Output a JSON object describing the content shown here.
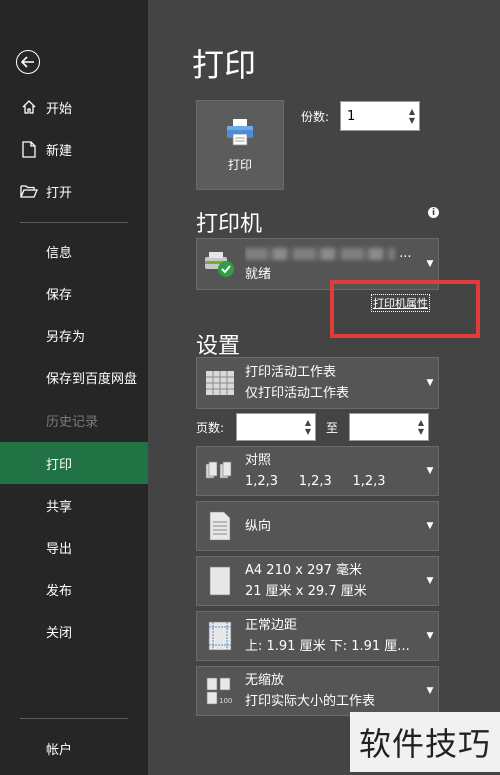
{
  "sidebar": {
    "items": [
      {
        "label": "开始",
        "icon": "home-icon"
      },
      {
        "label": "新建",
        "icon": "new-document-icon"
      },
      {
        "label": "打开",
        "icon": "open-folder-icon"
      },
      {
        "label": "信息"
      },
      {
        "label": "保存"
      },
      {
        "label": "另存为"
      },
      {
        "label": "保存到百度网盘"
      },
      {
        "label": "历史记录",
        "disabled": true
      },
      {
        "label": "打印",
        "active": true
      },
      {
        "label": "共享"
      },
      {
        "label": "导出"
      },
      {
        "label": "发布"
      },
      {
        "label": "关闭"
      },
      {
        "label": "帐户"
      }
    ],
    "active_color": "#217346"
  },
  "main": {
    "title": "打印",
    "print_button_label": "打印",
    "copies_label": "份数:",
    "copies_value": "1",
    "printer_heading": "打印机",
    "printer_status": "就绪",
    "printer_name_suffix": "...",
    "printer_properties": "打印机属性",
    "settings_heading": "设置",
    "settings": [
      {
        "line1": "打印活动工作表",
        "line2": "仅打印活动工作表",
        "icon": "sheet-grid-icon"
      },
      {
        "line1": "对照",
        "line2": "1,2,3     1,2,3     1,2,3",
        "icon": "collate-icon"
      },
      {
        "line1": "纵向",
        "line2": "",
        "icon": "portrait-page-icon"
      },
      {
        "line1": "A4 210 x 297 毫米",
        "line2": "21 厘米 x 29.7 厘米",
        "icon": "paper-size-icon"
      },
      {
        "line1": "正常边距",
        "line2": "上: 1.91 厘米 下: 1.91 厘...",
        "icon": "margins-icon"
      },
      {
        "line1": "无缩放",
        "line2": "打印实际大小的工作表",
        "icon": "no-scaling-icon"
      }
    ],
    "pages_label": "页数:",
    "to_label": "至",
    "pages_from": "",
    "pages_to": ""
  },
  "watermark": "软件技巧",
  "highlight_color": "#e23b3b"
}
